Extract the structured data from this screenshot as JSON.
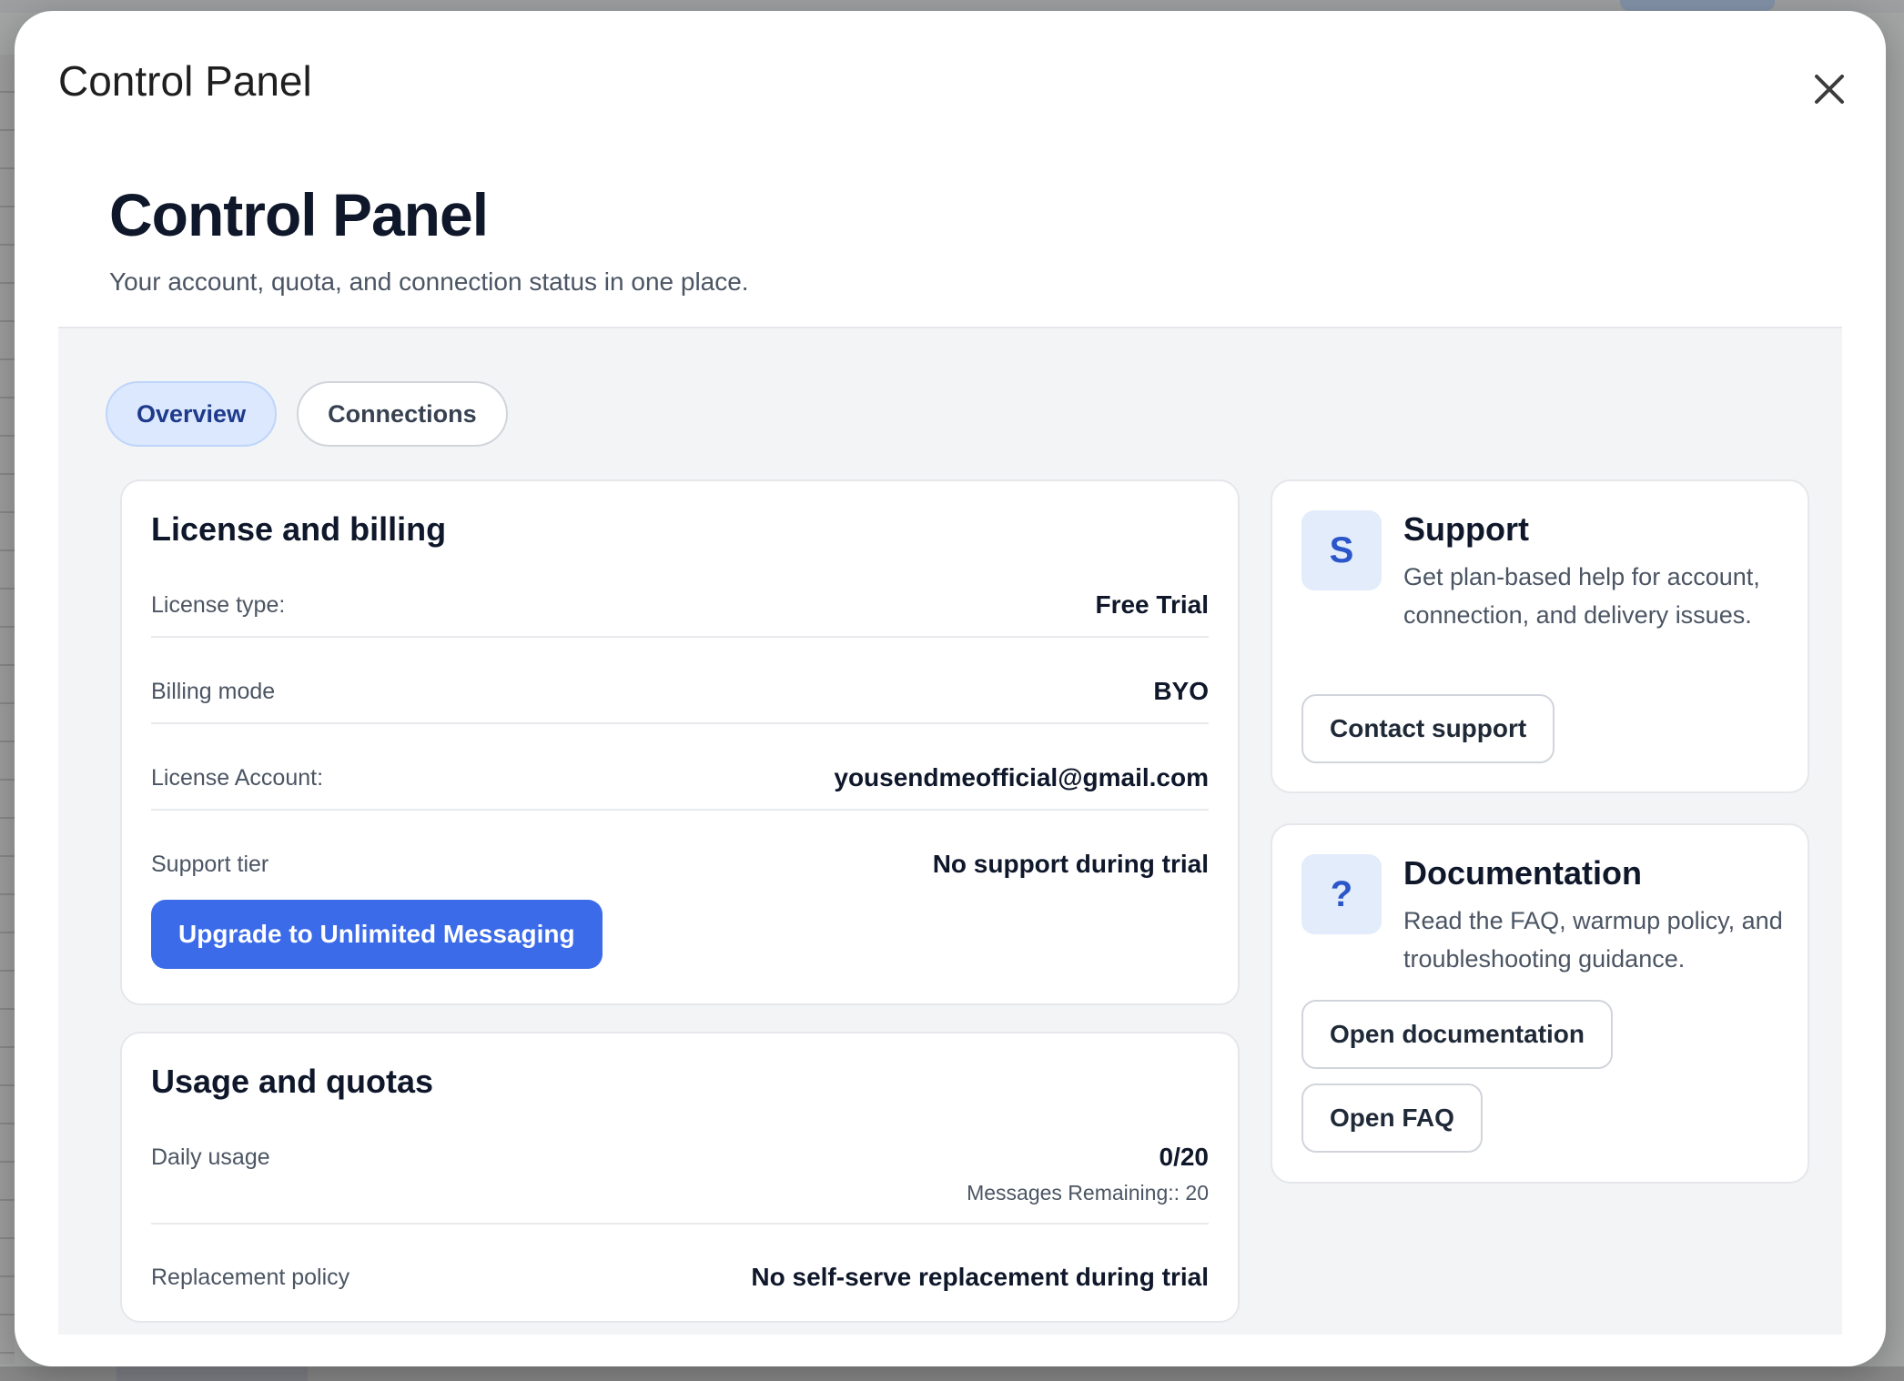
{
  "modal": {
    "title": "Control Panel",
    "close_label": "close"
  },
  "page": {
    "heading": "Control Panel",
    "subtitle": "Your account, quota, and connection status in one place."
  },
  "tabs": [
    {
      "label": "Overview",
      "active": true
    },
    {
      "label": "Connections",
      "active": false
    }
  ],
  "license_billing": {
    "title": "License and billing",
    "rows": [
      {
        "label": "License type:",
        "value": "Free Trial"
      },
      {
        "label": "Billing mode",
        "value": "BYO"
      },
      {
        "label": "License Account:",
        "value": "yousendmeofficial@gmail.com"
      },
      {
        "label": "Support tier",
        "value": "No support during trial"
      }
    ],
    "upgrade_label": "Upgrade to Unlimited Messaging"
  },
  "usage_quotas": {
    "title": "Usage and quotas",
    "daily_usage_label": "Daily usage",
    "daily_usage_value": "0/20",
    "messages_remaining": "Messages Remaining:: 20",
    "replacement_label": "Replacement policy",
    "replacement_value": "No self-serve replacement during trial"
  },
  "support": {
    "badge": "S",
    "title": "Support",
    "description": "Get plan-based help for account, connection, and delivery issues.",
    "contact_label": "Contact support"
  },
  "documentation": {
    "badge": "?",
    "title": "Documentation",
    "description": "Read the FAQ, warmup policy, and troubleshooting guidance.",
    "open_docs_label": "Open documentation",
    "open_faq_label": "Open FAQ"
  },
  "colors": {
    "primary": "#3b6be8",
    "tab_active_bg": "#dbe8fd",
    "badge_bg": "#e3ecfb",
    "badge_fg": "#2b56c9"
  },
  "icons": {
    "close": "close-icon"
  }
}
